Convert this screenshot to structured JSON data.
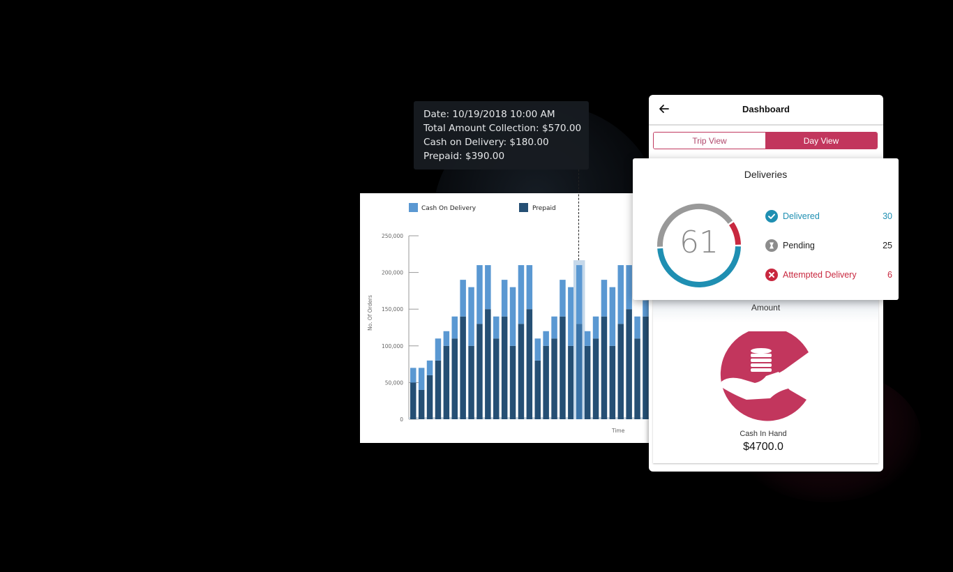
{
  "tooltip": {
    "date": "Date: 10/19/2018 10:00 AM",
    "total": "Total Amount Collection: $570.00",
    "cod": "Cash on Delivery: $180.00",
    "prepaid": "Prepaid: $390.00"
  },
  "chart_data": {
    "type": "bar",
    "stacked": true,
    "title": "",
    "xlabel": "Time",
    "ylabel": "No. Of Orders",
    "ylim": [
      0,
      250000
    ],
    "yticks": [
      "0",
      "50,000",
      "100,000",
      "150,000",
      "200,000",
      "250,000"
    ],
    "grid": false,
    "legend": "top",
    "highlighted_index": 20,
    "series": [
      {
        "name": "Prepaid",
        "color": "#254f74",
        "values": [
          50000,
          40000,
          60000,
          80000,
          100000,
          110000,
          140000,
          100000,
          130000,
          150000,
          110000,
          140000,
          100000,
          130000,
          150000,
          80000,
          100000,
          110000,
          140000,
          100000,
          130000,
          100000,
          110000,
          140000,
          100000,
          130000,
          150000,
          110000,
          140000
        ]
      },
      {
        "name": "Cash On Delivery",
        "color": "#5a98d2",
        "values": [
          20000,
          30000,
          20000,
          30000,
          20000,
          30000,
          50000,
          80000,
          80000,
          60000,
          30000,
          50000,
          80000,
          80000,
          60000,
          30000,
          20000,
          30000,
          50000,
          80000,
          80000,
          20000,
          30000,
          50000,
          80000,
          80000,
          60000,
          30000,
          22000
        ]
      }
    ]
  },
  "legend": [
    {
      "label": "Cash On Delivery",
      "color": "#5a98d2"
    },
    {
      "label": "Prepaid",
      "color": "#254f74"
    }
  ],
  "dashboard": {
    "title": "Dashboard",
    "back_icon": "arrow-left-icon",
    "tabs": [
      {
        "label": "Trip View",
        "active": false
      },
      {
        "label": "Day View",
        "active": true
      }
    ],
    "accent": "#c2365d"
  },
  "deliveries": {
    "title": "Deliveries",
    "total": "61",
    "items": [
      {
        "label": "Delivered",
        "value": "30",
        "icon": "check-circle-icon",
        "color": "#1f8fb2"
      },
      {
        "label": "Pending",
        "value": "25",
        "icon": "hourglass-icon",
        "color": "#8c8c8c"
      },
      {
        "label": "Attempted Delivery",
        "value": "6",
        "icon": "x-circle-icon",
        "color": "#c8283f"
      }
    ]
  },
  "amount": {
    "title": "Amount",
    "cash_label": "Cash In Hand",
    "cash_value": "$4700.0"
  }
}
